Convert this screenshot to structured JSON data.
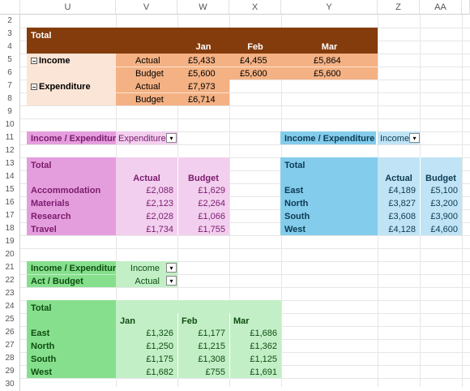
{
  "columns": [
    "U",
    "V",
    "W",
    "X",
    "Y",
    "Z",
    "AA",
    "AB"
  ],
  "rows": [
    "2",
    "3",
    "4",
    "5",
    "6",
    "7",
    "8",
    "9",
    "10",
    "11",
    "12",
    "13",
    "14",
    "15",
    "16",
    "17",
    "18",
    "19",
    "20",
    "21",
    "22",
    "23",
    "24",
    "25",
    "26",
    "27",
    "28",
    "29",
    "30"
  ],
  "colors": {
    "brown": "#843c0c",
    "peach_dark": "#f4b183",
    "peach_light": "#fbe5d6",
    "pink_dark": "#e59edd",
    "pink_light": "#f2cfee",
    "blue_dark": "#83cceb",
    "blue_light": "#c0e4f5",
    "green_dark": "#86df8c",
    "green_light": "#c3efc6"
  },
  "pivot1": {
    "total": "Total",
    "months": [
      "Jan",
      "Feb",
      "Mar"
    ],
    "income": "Income",
    "expenditure": "Expenditure",
    "actual": "Actual",
    "budget": "Budget",
    "income_actual": [
      "£5,433",
      "£4,455",
      "£5,864"
    ],
    "income_budget": [
      "£5,600",
      "£5,600",
      "£5,600"
    ],
    "exp_actual": "£7,973",
    "exp_budget": "£6,714"
  },
  "pivot2": {
    "filter_label": "Income / Expenditure",
    "filter_value": "Expenditure",
    "total": "Total",
    "col_actual": "Actual",
    "col_budget": "Budget",
    "rows": [
      {
        "label": "Accommodation",
        "actual": "£2,088",
        "budget": "£1,629"
      },
      {
        "label": "Materials",
        "actual": "£2,123",
        "budget": "£2,264"
      },
      {
        "label": "Research",
        "actual": "£2,028",
        "budget": "£1,066"
      },
      {
        "label": "Travel",
        "actual": "£1,734",
        "budget": "£1,755"
      }
    ]
  },
  "pivot3": {
    "filter_label": "Income / Expenditure",
    "filter_value": "Income",
    "total": "Total",
    "col_actual": "Actual",
    "col_budget": "Budget",
    "rows": [
      {
        "label": "East",
        "actual": "£4,189",
        "budget": "£5,100"
      },
      {
        "label": "North",
        "actual": "£3,827",
        "budget": "£3,200"
      },
      {
        "label": "South",
        "actual": "£3,608",
        "budget": "£3,900"
      },
      {
        "label": "West",
        "actual": "£4,128",
        "budget": "£4,600"
      }
    ]
  },
  "pivot4": {
    "filter1_label": "Income / Expenditure",
    "filter1_value": "Income",
    "filter2_label": "Act / Budget",
    "filter2_value": "Actual",
    "total": "Total",
    "months": [
      "Jan",
      "Feb",
      "Mar"
    ],
    "rows": [
      {
        "label": "East",
        "v": [
          "£1,326",
          "£1,177",
          "£1,686"
        ]
      },
      {
        "label": "North",
        "v": [
          "£1,250",
          "£1,215",
          "£1,362"
        ]
      },
      {
        "label": "South",
        "v": [
          "£1,175",
          "£1,308",
          "£1,125"
        ]
      },
      {
        "label": "West",
        "v": [
          "£1,682",
          "£755",
          "£1,691"
        ]
      }
    ]
  }
}
